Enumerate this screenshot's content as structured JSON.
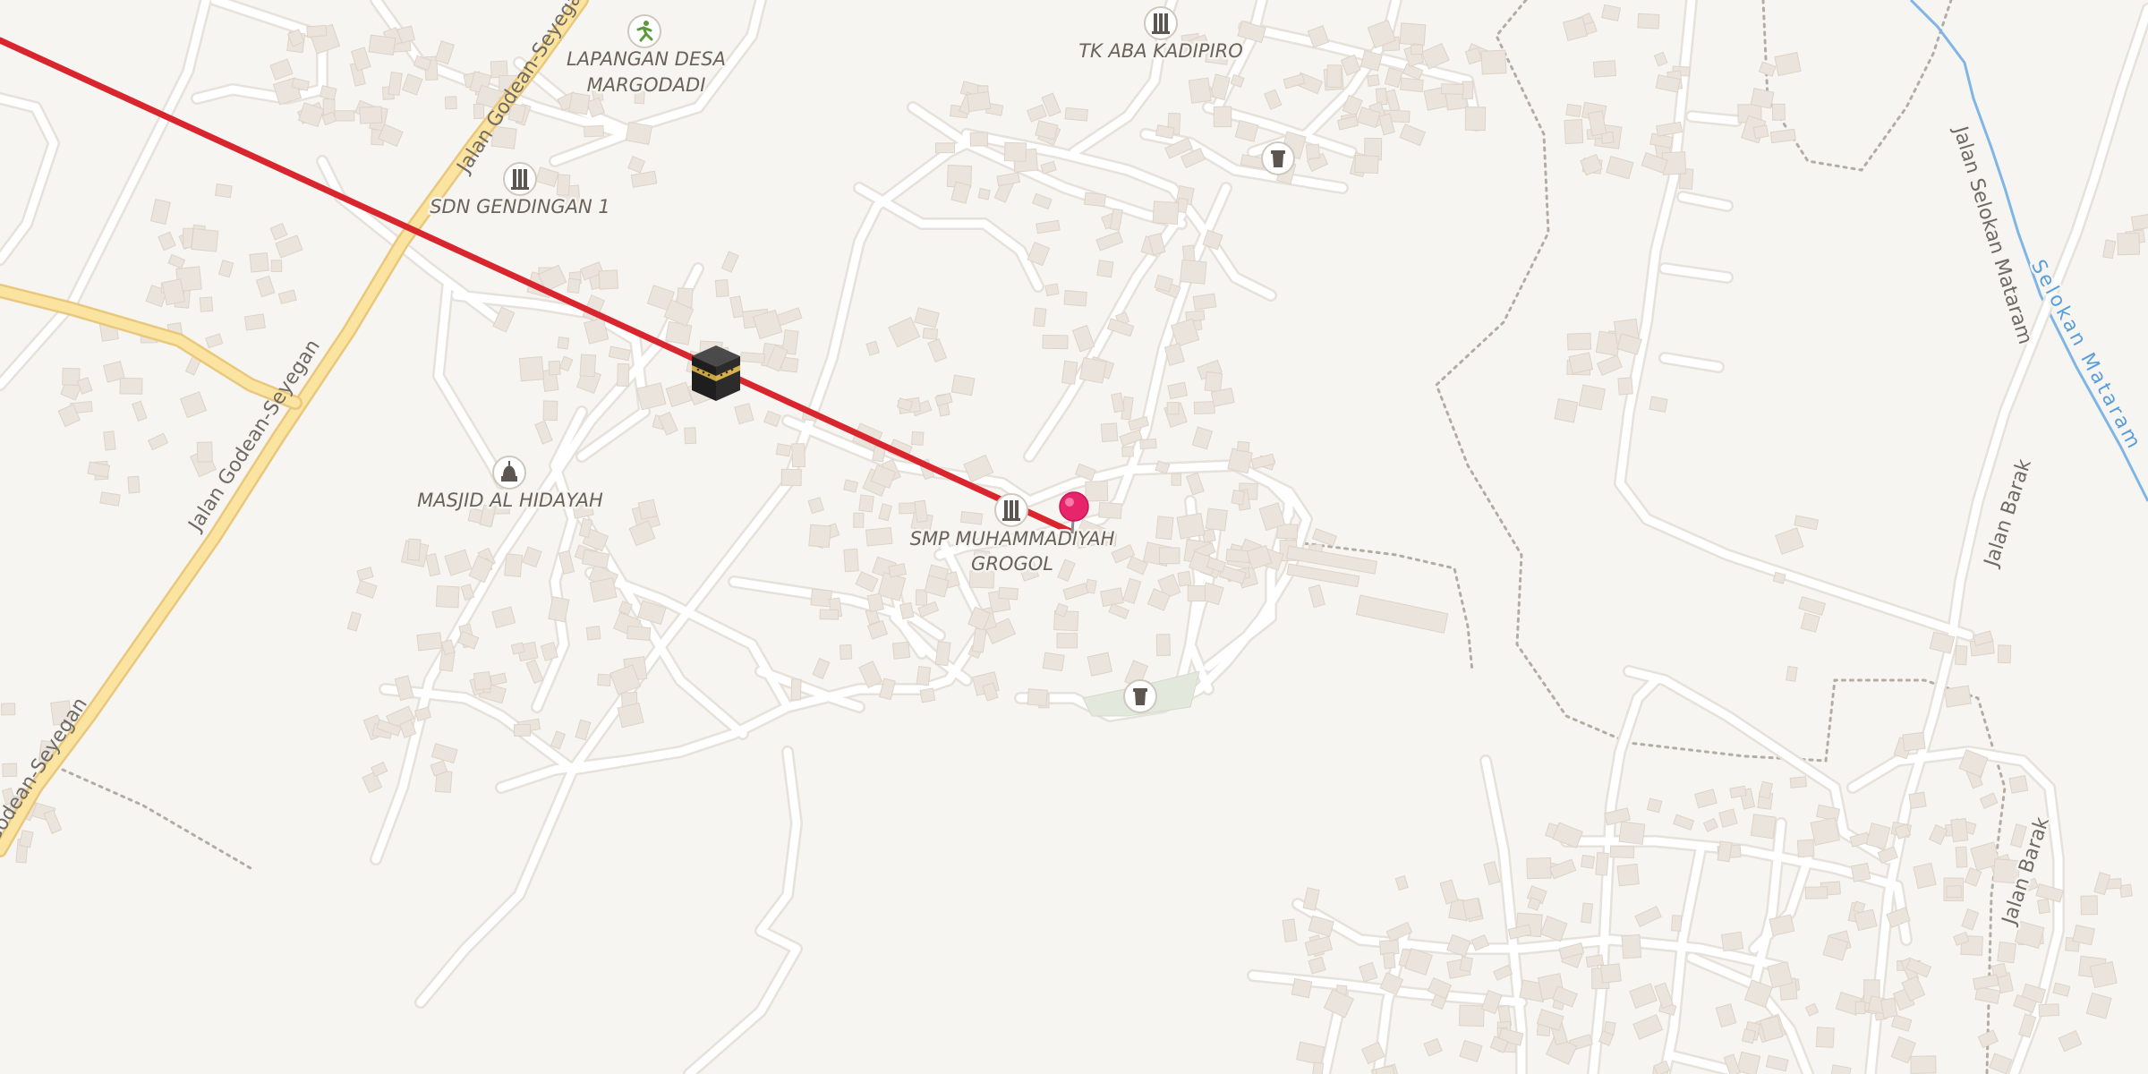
{
  "map": {
    "poi_labels": {
      "lapangan_line1": "LAPANGAN DESA",
      "lapangan_line2": "MARGODADI",
      "tk_aba": "TK ABA KADIPIRO",
      "sdn": "SDN GENDINGAN 1",
      "masjid": "MASJID AL HIDAYAH",
      "smp_line1": "SMP MUHAMMADIYAH",
      "smp_line2": "GROGOL"
    },
    "street_labels": {
      "godean_top": "Jalan Godean-Seyegan",
      "godean_mid": "Jalan Godean-Seyegan",
      "godean_bottom": "Jalan Godean-Seyegan",
      "selokan_jalan": "Jalan Selokan Mataram",
      "barak_mid": "Jalan Barak",
      "barak_bottom": "Jalan Barak"
    },
    "water_labels": {
      "selokan_river": "Selokan Mataram"
    },
    "icons": {
      "kaaba": "kaaba-icon",
      "location_pin": "location-pin-icon",
      "school": "school-icon",
      "mosque": "mosque-icon",
      "sports": "running-person-icon",
      "cemetery": "cemetery-icon"
    },
    "colors": {
      "qibla_line": "#d9262e",
      "pin": "#e8246b",
      "major_road": "#fbe3a0",
      "water": "#7fb6e6",
      "background": "#f7f5f1"
    }
  }
}
